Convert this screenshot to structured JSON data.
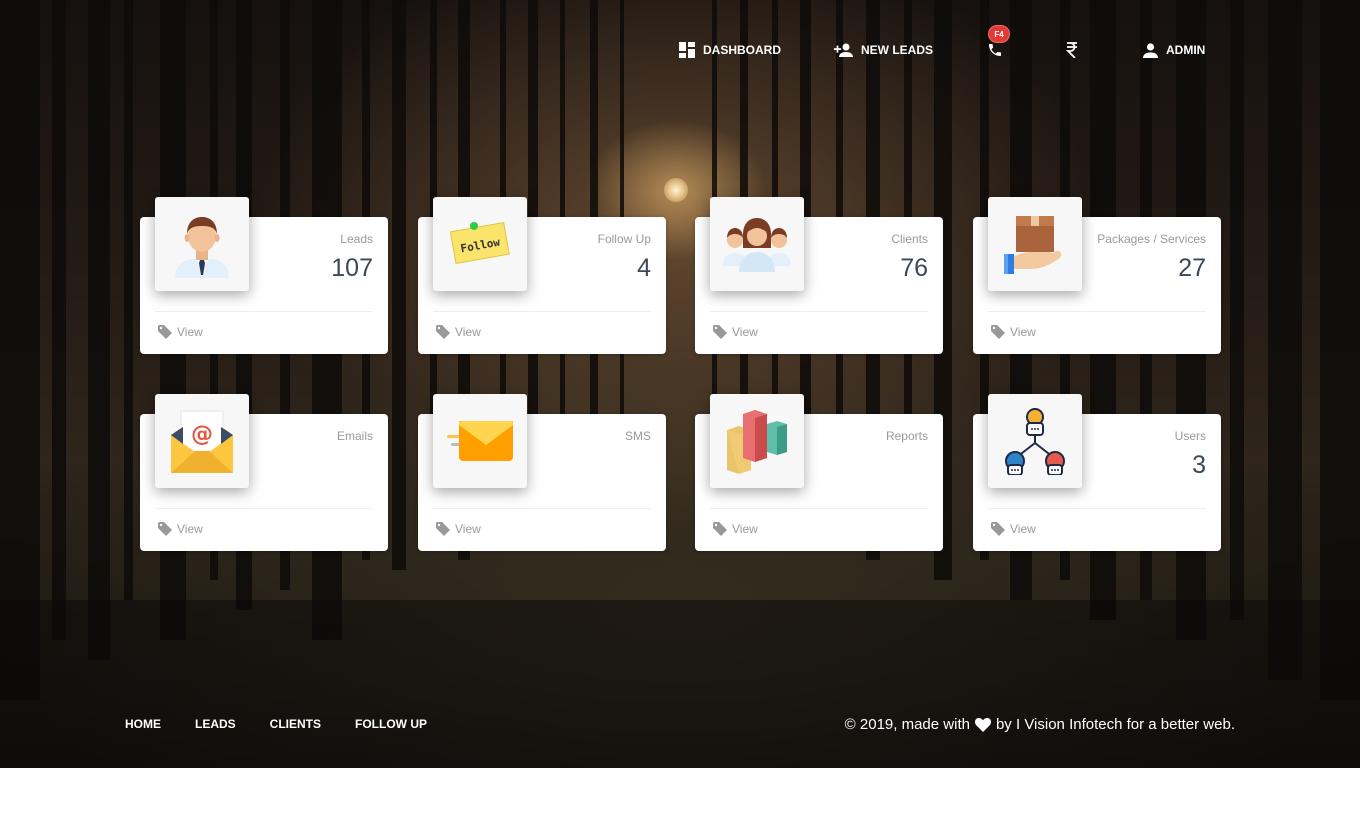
{
  "nav": {
    "dashboard": "Dashboard",
    "new_leads": "New Leads",
    "call_badge": "F4",
    "admin": "Admin"
  },
  "cards": [
    {
      "title": "Leads",
      "value": "107",
      "footer": "View",
      "icon": "businessman-icon"
    },
    {
      "title": "Follow Up",
      "value": "4",
      "footer": "View",
      "icon": "sticky-note-icon",
      "icon_text": "Follow"
    },
    {
      "title": "Clients",
      "value": "76",
      "footer": "View",
      "icon": "group-icon"
    },
    {
      "title": "Packages / Services",
      "value": "27",
      "footer": "View",
      "icon": "package-hand-icon"
    },
    {
      "title": "Emails",
      "value": "",
      "footer": "View",
      "icon": "envelope-at-icon"
    },
    {
      "title": "SMS",
      "value": "",
      "footer": "View",
      "icon": "fast-mail-icon"
    },
    {
      "title": "Reports",
      "value": "",
      "footer": "View",
      "icon": "bar-blocks-icon"
    },
    {
      "title": "Users",
      "value": "3",
      "footer": "View",
      "icon": "user-network-icon"
    }
  ],
  "footer": {
    "links": [
      "Home",
      "Leads",
      "Clients",
      "Follow Up"
    ],
    "copyright_prefix": "© 2019, made with",
    "copyright_suffix": "by I Vision Infotech for a better web."
  },
  "colors": {
    "badge": "#e53935",
    "card_text": "#999999",
    "card_value": "#3c4858"
  }
}
